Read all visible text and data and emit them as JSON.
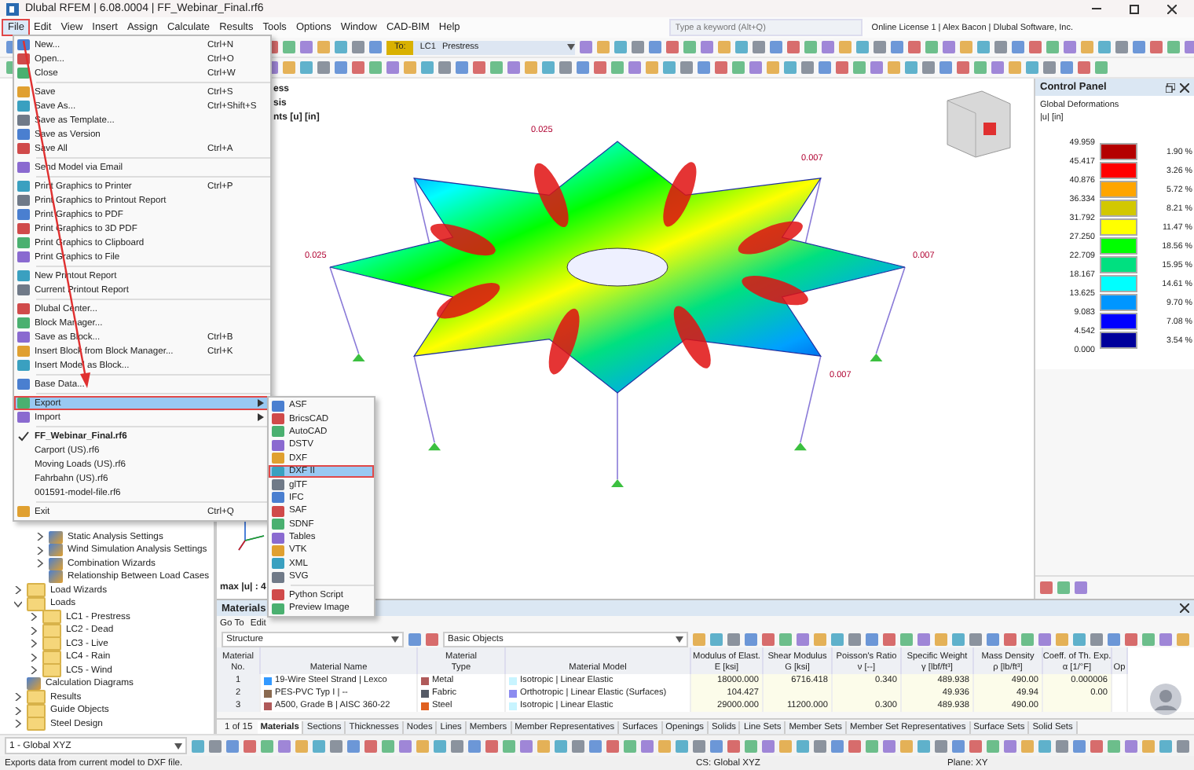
{
  "window": {
    "title": "Dlubal RFEM | 6.08.0004 | FF_Webinar_Final.rf6"
  },
  "menu_bar": [
    {
      "label": "File",
      "selected": true,
      "highlighted": true
    },
    {
      "label": "Edit",
      "selected": false,
      "highlighted": false
    },
    {
      "label": "View",
      "selected": false,
      "highlighted": false
    },
    {
      "label": "Insert",
      "selected": false,
      "highlighted": false
    },
    {
      "label": "Assign",
      "selected": false,
      "highlighted": false
    },
    {
      "label": "Calculate",
      "selected": false,
      "highlighted": false
    },
    {
      "label": "Results",
      "selected": false,
      "highlighted": false
    },
    {
      "label": "Tools",
      "selected": false,
      "highlighted": false
    },
    {
      "label": "Options",
      "selected": false,
      "highlighted": false
    },
    {
      "label": "Window",
      "selected": false,
      "highlighted": false
    },
    {
      "label": "CAD-BIM",
      "selected": false,
      "highlighted": false
    },
    {
      "label": "Help",
      "selected": false,
      "highlighted": false
    }
  ],
  "search": {
    "placeholder": "Type a keyword (Alt+Q)"
  },
  "license": "Online License 1 | Alex Bacon | Dlubal Software, Inc.",
  "load_case": {
    "tag": "To:",
    "number": "LC1",
    "name": "Prestress"
  },
  "file_menu": [
    {
      "kind": "item",
      "label": "New...",
      "shortcut": "Ctrl+N",
      "selected": false,
      "highlighted": false
    },
    {
      "kind": "item",
      "label": "Open...",
      "shortcut": "Ctrl+O",
      "selected": false,
      "highlighted": false
    },
    {
      "kind": "item",
      "label": "Close",
      "shortcut": "Ctrl+W",
      "selected": false,
      "highlighted": false
    },
    {
      "kind": "separator"
    },
    {
      "kind": "item",
      "label": "Save",
      "shortcut": "Ctrl+S",
      "selected": false,
      "highlighted": false
    },
    {
      "kind": "item",
      "label": "Save As...",
      "shortcut": "Ctrl+Shift+S",
      "selected": false,
      "highlighted": false
    },
    {
      "kind": "item",
      "label": "Save as Template...",
      "selected": false,
      "highlighted": false
    },
    {
      "kind": "item",
      "label": "Save as Version",
      "selected": false,
      "highlighted": false
    },
    {
      "kind": "item",
      "label": "Save All",
      "shortcut": "Ctrl+A",
      "selected": false,
      "highlighted": false
    },
    {
      "kind": "separator"
    },
    {
      "kind": "item",
      "label": "Send Model via Email",
      "selected": false,
      "highlighted": false
    },
    {
      "kind": "separator"
    },
    {
      "kind": "item",
      "label": "Print Graphics to Printer",
      "shortcut": "Ctrl+P",
      "selected": false,
      "highlighted": false
    },
    {
      "kind": "item",
      "label": "Print Graphics to Printout Report",
      "selected": false,
      "highlighted": false
    },
    {
      "kind": "item",
      "label": "Print Graphics to PDF",
      "selected": false,
      "highlighted": false
    },
    {
      "kind": "item",
      "label": "Print Graphics to 3D PDF",
      "selected": false,
      "highlighted": false
    },
    {
      "kind": "item",
      "label": "Print Graphics to Clipboard",
      "selected": false,
      "highlighted": false
    },
    {
      "kind": "item",
      "label": "Print Graphics to File",
      "selected": false,
      "highlighted": false
    },
    {
      "kind": "separator"
    },
    {
      "kind": "item",
      "label": "New Printout Report",
      "selected": false,
      "highlighted": false
    },
    {
      "kind": "item",
      "label": "Current Printout Report",
      "selected": false,
      "highlighted": false
    },
    {
      "kind": "separator"
    },
    {
      "kind": "item",
      "label": "Dlubal Center...",
      "selected": false,
      "highlighted": false
    },
    {
      "kind": "item",
      "label": "Block Manager...",
      "selected": false,
      "highlighted": false
    },
    {
      "kind": "item",
      "label": "Save as Block...",
      "shortcut": "Ctrl+B",
      "selected": false,
      "highlighted": false
    },
    {
      "kind": "item",
      "label": "Insert Block from Block Manager...",
      "shortcut": "Ctrl+K",
      "selected": false,
      "highlighted": false
    },
    {
      "kind": "item",
      "label": "Insert Model as Block...",
      "selected": false,
      "highlighted": false
    },
    {
      "kind": "separator"
    },
    {
      "kind": "item",
      "label": "Base Data...",
      "selected": false,
      "highlighted": false
    },
    {
      "kind": "separator"
    },
    {
      "kind": "submenu",
      "label": "Export",
      "selected": true,
      "highlighted": true
    },
    {
      "kind": "submenu",
      "label": "Import",
      "selected": false,
      "highlighted": false
    },
    {
      "kind": "separator"
    },
    {
      "kind": "recent",
      "label": "FF_Webinar_Final.rf6",
      "checked": true
    },
    {
      "kind": "recent",
      "label": "Carport (US).rf6",
      "checked": false
    },
    {
      "kind": "recent",
      "label": "Moving Loads (US).rf6",
      "checked": false
    },
    {
      "kind": "recent",
      "label": "Fahrbahn (US).rf6",
      "checked": false
    },
    {
      "kind": "recent",
      "label": "001591-model-file.rf6",
      "checked": false
    },
    {
      "kind": "separator"
    },
    {
      "kind": "item",
      "label": "Exit",
      "shortcut": "Ctrl+Q",
      "selected": false,
      "highlighted": false
    }
  ],
  "export_menu": [
    {
      "kind": "item",
      "label": "ASF",
      "selected": false,
      "highlighted": false
    },
    {
      "kind": "item",
      "label": "BricsCAD",
      "selected": false,
      "highlighted": false
    },
    {
      "kind": "item",
      "label": "AutoCAD",
      "selected": false,
      "highlighted": false
    },
    {
      "kind": "item",
      "label": "DSTV",
      "selected": false,
      "highlighted": false
    },
    {
      "kind": "item",
      "label": "DXF",
      "selected": false,
      "highlighted": false
    },
    {
      "kind": "item",
      "label": "DXF II",
      "selected": true,
      "highlighted": true
    },
    {
      "kind": "item",
      "label": "glTF",
      "selected": false,
      "highlighted": false
    },
    {
      "kind": "item",
      "label": "IFC",
      "selected": false,
      "highlighted": false
    },
    {
      "kind": "item",
      "label": "SAF",
      "selected": false,
      "highlighted": false
    },
    {
      "kind": "item",
      "label": "SDNF",
      "selected": false,
      "highlighted": false
    },
    {
      "kind": "item",
      "label": "Tables",
      "selected": false,
      "highlighted": false
    },
    {
      "kind": "item",
      "label": "VTK",
      "selected": false,
      "highlighted": false
    },
    {
      "kind": "item",
      "label": "XML",
      "selected": false,
      "highlighted": false
    },
    {
      "kind": "item",
      "label": "SVG",
      "selected": false,
      "highlighted": false
    },
    {
      "kind": "separator"
    },
    {
      "kind": "item",
      "label": "Python Script",
      "selected": false,
      "highlighted": false
    },
    {
      "kind": "item",
      "label": "Preview Image",
      "selected": false,
      "highlighted": false
    }
  ],
  "navigator": {
    "partial_branch": [
      {
        "kind": "branch",
        "label": "Static Analysis Settings",
        "expanded": false
      },
      {
        "kind": "branch",
        "label": "Wind Simulation Analysis Settings",
        "expanded": false
      },
      {
        "kind": "branch",
        "label": "Combination Wizards",
        "expanded": false
      },
      {
        "kind": "leaf",
        "label": "Relationship Between Load Cases"
      }
    ],
    "items": [
      {
        "kind": "folder",
        "label": "Load Wizards",
        "expanded": false
      },
      {
        "kind": "folder",
        "label": "Loads",
        "expanded": true,
        "children": [
          {
            "kind": "folder",
            "label": "LC1 - Prestress",
            "expanded": false
          },
          {
            "kind": "folder",
            "label": "LC2 - Dead",
            "expanded": false
          },
          {
            "kind": "folder",
            "label": "LC3 - Live",
            "expanded": false
          },
          {
            "kind": "folder",
            "label": "LC4 - Rain",
            "expanded": false
          },
          {
            "kind": "folder",
            "label": "LC5 - Wind",
            "expanded": false
          }
        ]
      },
      {
        "kind": "leaf",
        "label": "Calculation Diagrams"
      },
      {
        "kind": "folder",
        "label": "Results",
        "expanded": false
      },
      {
        "kind": "folder",
        "label": "Guide Objects",
        "expanded": false
      },
      {
        "kind": "folder",
        "label": "Steel Design",
        "expanded": false
      }
    ],
    "view": "1 - Global XYZ"
  },
  "viewport": {
    "info_lines": [
      "ess",
      "sis",
      "nts [u] [in]"
    ],
    "max_label": "max |u| : 4",
    "value_labels": [
      "0.025",
      "0.025",
      "0.007",
      "0.007",
      "0.007"
    ]
  },
  "control_panel": {
    "title": "Control Panel",
    "subtitle": "Global Deformations",
    "unit": "|u| [in]",
    "values": [
      "49.959",
      "45.417",
      "40.876",
      "36.334",
      "31.792",
      "27.250",
      "22.709",
      "18.167",
      "13.625",
      "9.083",
      "4.542",
      "0.000"
    ],
    "bands": [
      {
        "color": "#b40000",
        "percent": "1.90 %"
      },
      {
        "color": "#ff0000",
        "percent": "3.26 %"
      },
      {
        "color": "#ffa500",
        "percent": "5.72 %"
      },
      {
        "color": "#d2c800",
        "percent": "8.21 %"
      },
      {
        "color": "#ffff00",
        "percent": "11.47 %"
      },
      {
        "color": "#00ff00",
        "percent": "18.56 %"
      },
      {
        "color": "#00e080",
        "percent": "15.95 %"
      },
      {
        "color": "#00ffff",
        "percent": "14.61 %"
      },
      {
        "color": "#0096ff",
        "percent": "9.70 %"
      },
      {
        "color": "#0000ff",
        "percent": "7.08 %"
      },
      {
        "color": "#00009b",
        "percent": "3.54 %"
      }
    ]
  },
  "table": {
    "title": "Materials",
    "menu": [
      "Go To",
      "Edit"
    ],
    "filter": "Structure",
    "objects": "Basic Objects",
    "columns": [
      {
        "line1": "Material",
        "line2": "No."
      },
      {
        "line2": "Material Name"
      },
      {
        "line1": "Material",
        "line2": "Type"
      },
      {
        "line2": "Material Model"
      },
      {
        "line1": "Modulus of Elast.",
        "line2": "E [ksi]"
      },
      {
        "line1": "Shear Modulus",
        "line2": "G [ksi]"
      },
      {
        "line1": "Poisson's Ratio",
        "line2": "ν [--]"
      },
      {
        "line1": "Specific Weight",
        "line2": "γ [lbf/ft³]"
      },
      {
        "line1": "Mass Density",
        "line2": "ρ [lb/ft³]"
      },
      {
        "line1": "Coeff. of Th. Exp.",
        "line2": "α [1/°F]"
      },
      {
        "line2": "Op"
      }
    ],
    "rows": [
      {
        "no": "1",
        "name": {
          "text": "19-Wire Steel Strand | Lexco",
          "color": "#3399ff"
        },
        "type": {
          "text": "Metal",
          "color": "#b05a5a"
        },
        "model": {
          "text": "Isotropic | Linear Elastic",
          "color": "#c8f4ff"
        },
        "e": "18000.000",
        "g": "6716.418",
        "nu": "0.340",
        "gamma": "489.938",
        "rho": "490.00",
        "alpha": "0.000006"
      },
      {
        "no": "2",
        "name": {
          "text": "PES-PVC Typ I | --",
          "color": "#8a6a50"
        },
        "type": {
          "text": "Fabric",
          "color": "#555a66"
        },
        "model": {
          "text": "Orthotropic | Linear Elastic (Surfaces)",
          "color": "#8c8cf0"
        },
        "e": "104.427",
        "gamma": "49.936",
        "rho": "49.94",
        "alpha": "0.00"
      },
      {
        "no": "3",
        "name": {
          "text": "A500, Grade B | AISC 360-22",
          "color": "#b05a5a"
        },
        "type": {
          "text": "Steel",
          "color": "#e06020"
        },
        "model": {
          "text": "Isotropic | Linear Elastic",
          "color": "#c8f4ff"
        },
        "e": "29000.000",
        "g": "11200.000",
        "nu": "0.300",
        "gamma": "489.938",
        "rho": "490.00"
      }
    ],
    "pager": "1 of 15",
    "tabs": [
      {
        "label": "Materials",
        "selected": true
      },
      {
        "label": "Sections",
        "selected": false
      },
      {
        "label": "Thicknesses",
        "selected": false
      },
      {
        "label": "Nodes",
        "selected": false
      },
      {
        "label": "Lines",
        "selected": false
      },
      {
        "label": "Members",
        "selected": false
      },
      {
        "label": "Member Representatives",
        "selected": false
      },
      {
        "label": "Surfaces",
        "selected": false
      },
      {
        "label": "Openings",
        "selected": false
      },
      {
        "label": "Solids",
        "selected": false
      },
      {
        "label": "Line Sets",
        "selected": false
      },
      {
        "label": "Member Sets",
        "selected": false
      },
      {
        "label": "Member Set Representatives",
        "selected": false
      },
      {
        "label": "Surface Sets",
        "selected": false
      },
      {
        "label": "Solid Sets",
        "selected": false
      }
    ]
  },
  "status_bar": {
    "message": "Exports data from current model to DXF file.",
    "cs": "CS: Global XYZ",
    "plane": "Plane: XY"
  }
}
